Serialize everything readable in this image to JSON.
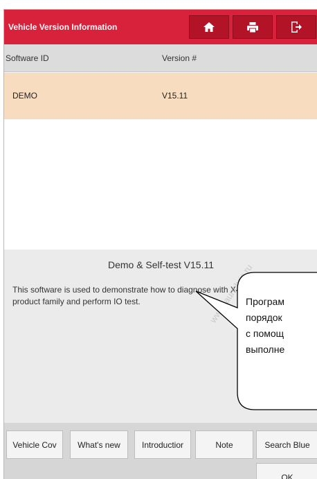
{
  "header": {
    "title": "Vehicle Version Information",
    "buttons": [
      {
        "icon": "home-icon"
      },
      {
        "icon": "print-icon"
      },
      {
        "icon": "exit-icon"
      }
    ]
  },
  "table": {
    "columns": [
      "Software ID",
      "Version #"
    ],
    "rows": [
      {
        "software_id": "DEMO",
        "version": "V15.11"
      }
    ]
  },
  "info": {
    "title": "Demo & Self-test V15.11",
    "text_line1": "This software is used to demonstrate how to diagnose with X431",
    "text_line2": "product family and perform IO test."
  },
  "watermark": "www.launchris.ru",
  "callout": {
    "lines": [
      "Програм",
      "порядок",
      "с помощ",
      "выполне"
    ]
  },
  "footer": {
    "buttons": [
      "Vehicle Cov",
      "What's new",
      "Introductior",
      "Note",
      "Search Blue"
    ],
    "ok": "OK"
  },
  "colors": {
    "titlebar": "#d8213b",
    "selected_row": "#f8dcbf"
  }
}
